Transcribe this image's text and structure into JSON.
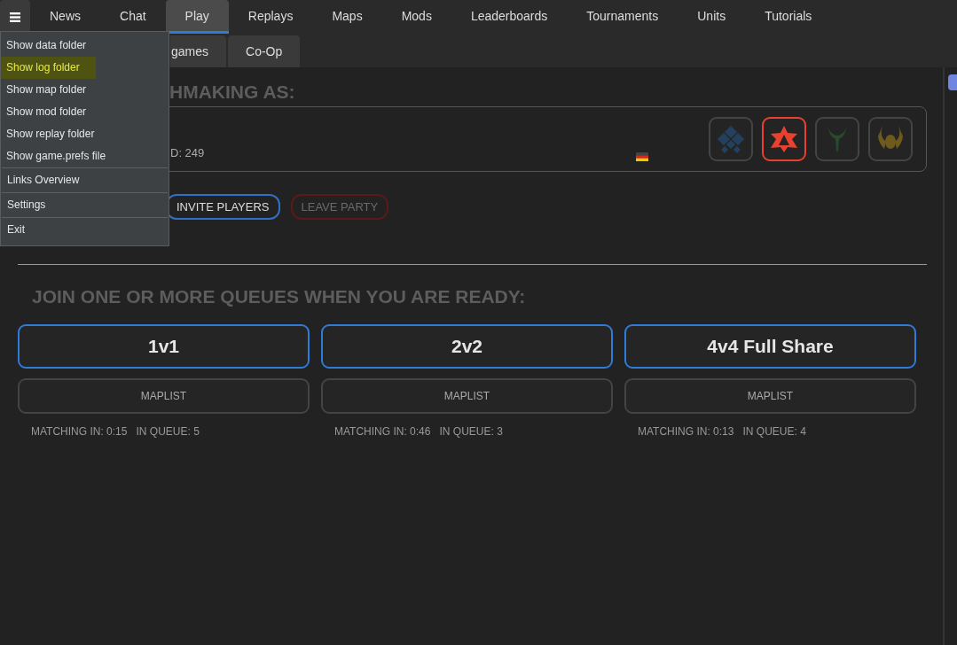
{
  "tabs": [
    {
      "label": "News",
      "selected": false
    },
    {
      "label": "Chat",
      "selected": false
    },
    {
      "label": "Play",
      "selected": true
    },
    {
      "label": "Replays",
      "selected": false
    },
    {
      "label": "Maps",
      "selected": false
    },
    {
      "label": "Mods",
      "selected": false
    },
    {
      "label": "Leaderboards",
      "selected": false
    },
    {
      "label": "Tournaments",
      "selected": false
    },
    {
      "label": "Units",
      "selected": false
    },
    {
      "label": "Tutorials",
      "selected": false
    }
  ],
  "subtabs": [
    {
      "label": "games",
      "selected": false
    },
    {
      "label": "Co-Op",
      "selected": false
    }
  ],
  "menu": {
    "groups": [
      [
        {
          "label": "Show data folder",
          "selected": false
        },
        {
          "label": "Show log folder",
          "selected": true
        },
        {
          "label": "Show map folder",
          "selected": false
        },
        {
          "label": "Show mod folder",
          "selected": false
        },
        {
          "label": "Show replay folder",
          "selected": false
        },
        {
          "label": "Show game.prefs file",
          "selected": false
        }
      ],
      [
        {
          "label": "Links Overview",
          "selected": false
        }
      ],
      [
        {
          "label": "Settings",
          "selected": false
        }
      ],
      [
        {
          "label": "Exit",
          "selected": false
        }
      ]
    ]
  },
  "party_heading": "HMAKING AS:",
  "player": {
    "rating": "D: 249"
  },
  "factions": [
    {
      "kind": "diamond",
      "color": "#24405f",
      "selected": false
    },
    {
      "kind": "triangle",
      "color": "#e8412f",
      "selected": true
    },
    {
      "kind": "crescent",
      "color": "#28492b",
      "selected": false
    },
    {
      "kind": "beetle",
      "color": "#6e5a1d",
      "selected": false
    }
  ],
  "party_buttons": [
    {
      "label": "INVITE PLAYERS",
      "disabled": false
    },
    {
      "label": "LEAVE PARTY",
      "disabled": true
    }
  ],
  "queues_heading": "JOIN ONE OR MORE QUEUES WHEN YOU ARE READY:",
  "queues": [
    {
      "name": "1v1",
      "maplist": "MAPLIST",
      "matching": "MATCHING IN: 0:15",
      "in_queue": "IN QUEUE: 5"
    },
    {
      "name": "2v2",
      "maplist": "MAPLIST",
      "matching": "MATCHING IN: 0:46",
      "in_queue": "IN QUEUE: 3"
    },
    {
      "name": "4v4 Full Share",
      "maplist": "MAPLIST",
      "matching": "MATCHING IN: 0:13",
      "in_queue": "IN QUEUE: 4"
    }
  ]
}
